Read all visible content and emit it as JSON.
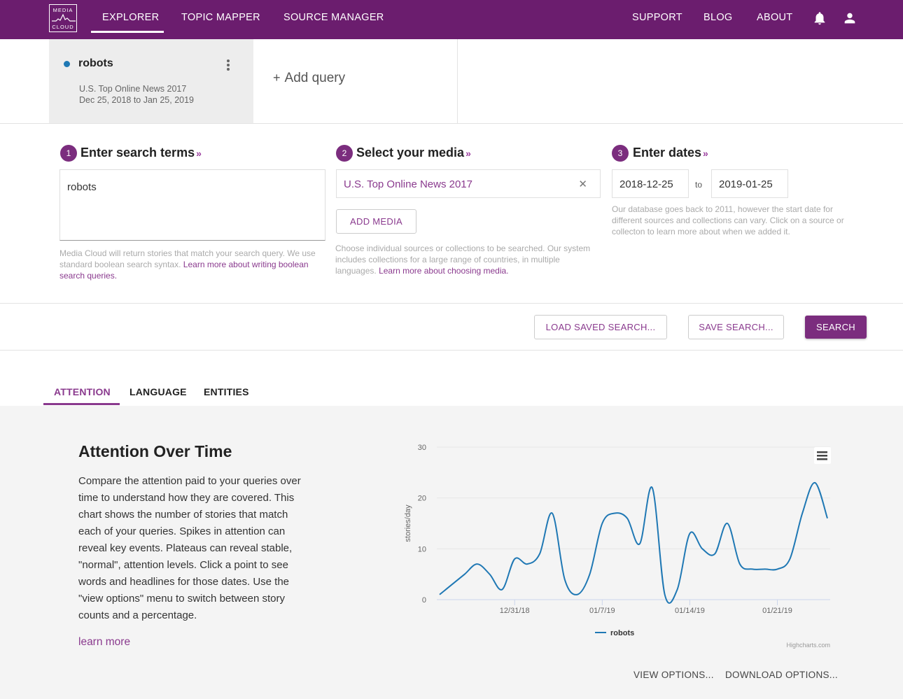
{
  "nav": {
    "logo_top": "MEDIA",
    "logo_bottom": "CLOUD",
    "items": [
      "EXPLORER",
      "TOPIC MAPPER",
      "SOURCE MANAGER"
    ],
    "right_items": [
      "SUPPORT",
      "BLOG",
      "ABOUT"
    ],
    "icons": [
      "bell-icon",
      "user-icon"
    ],
    "active": "EXPLORER"
  },
  "query": {
    "name": "robots",
    "color": "#1f78b4",
    "collection": "U.S. Top Online News 2017",
    "dates": "Dec 25, 2018 to Jan 25, 2019",
    "add_label": "Add query"
  },
  "steps": {
    "s1": {
      "num": "1",
      "title": "Enter search terms",
      "value": "robots",
      "help": "Media Cloud will return stories that match your search query. We use standard boolean search syntax.",
      "help_link": "Learn more about writing boolean search queries."
    },
    "s2": {
      "num": "2",
      "title": "Select your media",
      "selected": "U.S. Top Online News 2017",
      "add_button": "ADD MEDIA",
      "help": "Choose individual sources or collections to be searched. Our system includes collections for a large range of countries, in multiple languages.",
      "help_link": "Learn more about choosing media."
    },
    "s3": {
      "num": "3",
      "title": "Enter dates",
      "start": "2018-12-25",
      "to": "to",
      "end": "2019-01-25",
      "help": "Our database goes back to 2011, however the start date for different sources and collections can vary. Click on a source or collecton to learn more about when we added it."
    }
  },
  "actions": {
    "load": "LOAD SAVED SEARCH...",
    "save": "SAVE SEARCH...",
    "search": "SEARCH"
  },
  "tabs": [
    "ATTENTION",
    "LANGUAGE",
    "ENTITIES"
  ],
  "attention": {
    "title": "Attention Over Time",
    "description": "Compare the attention paid to your queries over time to understand how they are covered. This chart shows the number of stories that match each of your queries. Spikes in attention can reveal key events. Plateaus can reveal stable, \"normal\", attention levels. Click a point to see words and headlines for those dates. Use the \"view options\" menu to switch between story counts and a percentage.",
    "learn_more": "learn more",
    "view_options": "VIEW OPTIONS...",
    "download_options": "DOWNLOAD OPTIONS..."
  },
  "chart_data": {
    "type": "line",
    "ylabel": "stories/day",
    "ylim": [
      0,
      30
    ],
    "yticks": [
      0,
      10,
      20,
      30
    ],
    "x_tick_labels": [
      "12/31/18",
      "01/7/19",
      "01/14/19",
      "01/21/19"
    ],
    "x_tick_dates": [
      "2018-12-31",
      "2019-01-07",
      "2019-01-14",
      "2019-01-21"
    ],
    "credit": "Highcharts.com",
    "series": [
      {
        "name": "robots",
        "color": "#1f78b4",
        "x": [
          "2018-12-25",
          "2018-12-26",
          "2018-12-27",
          "2018-12-28",
          "2018-12-29",
          "2018-12-30",
          "2018-12-31",
          "2019-01-01",
          "2019-01-02",
          "2019-01-03",
          "2019-01-04",
          "2019-01-05",
          "2019-01-06",
          "2019-01-07",
          "2019-01-08",
          "2019-01-09",
          "2019-01-10",
          "2019-01-11",
          "2019-01-12",
          "2019-01-13",
          "2019-01-14",
          "2019-01-15",
          "2019-01-16",
          "2019-01-17",
          "2019-01-18",
          "2019-01-19",
          "2019-01-20",
          "2019-01-21",
          "2019-01-22",
          "2019-01-23",
          "2019-01-24",
          "2019-01-25"
        ],
        "y": [
          1,
          3,
          5,
          7,
          5,
          2,
          8,
          7,
          9,
          17,
          4,
          1,
          5,
          15,
          17,
          16,
          11,
          22,
          1,
          2,
          13,
          10,
          9,
          15,
          7,
          6,
          6,
          6,
          8,
          17,
          23,
          16
        ]
      }
    ]
  }
}
